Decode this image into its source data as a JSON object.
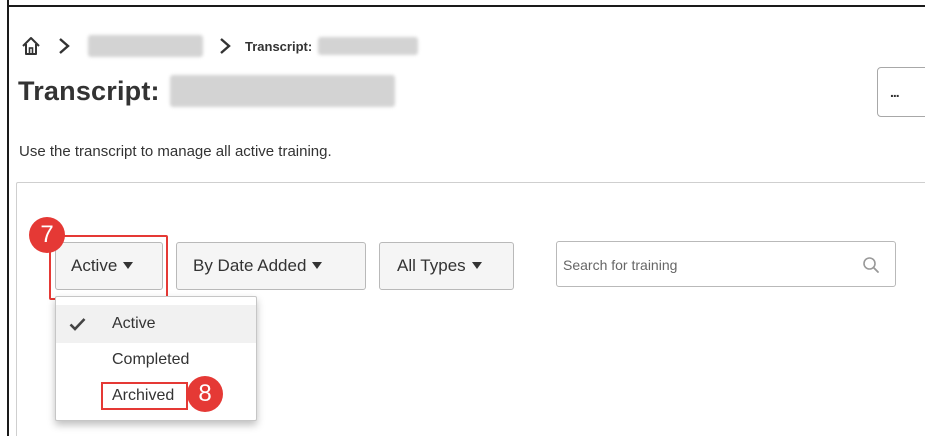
{
  "breadcrumb": {
    "current_label": "Transcript:"
  },
  "page": {
    "title": "Transcript:",
    "more_label": "...",
    "description": "Use the transcript to manage all active training."
  },
  "filters": {
    "status_label": "Active",
    "sort_label": "By Date Added",
    "types_label": "All Types"
  },
  "search": {
    "placeholder": "Search for training"
  },
  "status_menu": {
    "items": [
      {
        "label": "Active",
        "selected": true
      },
      {
        "label": "Completed",
        "selected": false
      },
      {
        "label": "Archived",
        "selected": false
      }
    ]
  },
  "annotations": {
    "step_7": "7",
    "step_8": "8",
    "color": "#e53935"
  },
  "icons": [
    "home-icon",
    "chevron-right-icon",
    "caret-down-icon",
    "search-icon",
    "check-icon"
  ]
}
